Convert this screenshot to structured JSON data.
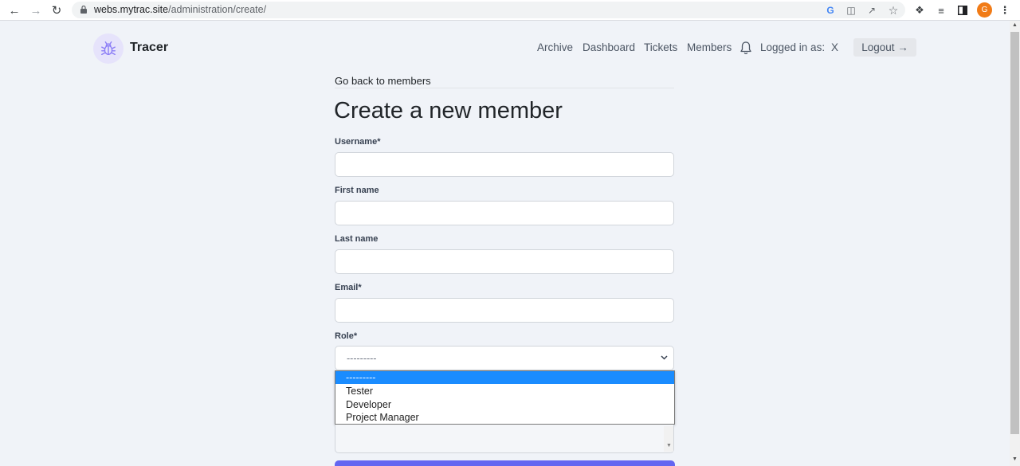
{
  "browser": {
    "url_domain": "webs.mytrac.site",
    "url_path": "/administration/create/",
    "profile_initial": "G",
    "icons": [
      "back-arrow-icon",
      "forward-arrow-icon",
      "reload-icon",
      "lock-icon",
      "google-icon",
      "translate-icon",
      "share-icon",
      "star-icon",
      "extensions-icon",
      "reading-list-icon",
      "side-panel-icon",
      "menu-icon"
    ]
  },
  "brand": {
    "name": "Tracer",
    "logo_icon": "bug-icon",
    "logo_color": "#8b7cf6"
  },
  "topnav": {
    "items": [
      "Archive",
      "Dashboard",
      "Tickets",
      "Members"
    ],
    "logged_in_label": "Logged in as:",
    "username": "X",
    "logout_label": "Logout →"
  },
  "page": {
    "back_link": "Go back to members",
    "title": "Create a new member"
  },
  "form": {
    "username_label": "Username*",
    "first_name_label": "First name",
    "last_name_label": "Last name",
    "email_label": "Email*",
    "role_label": "Role*",
    "role_value": "---------",
    "role_options": [
      "---------",
      "Tester",
      "Developer",
      "Project Manager"
    ],
    "accent_color": "#6366f1",
    "highlight_color": "#1a8cff"
  }
}
